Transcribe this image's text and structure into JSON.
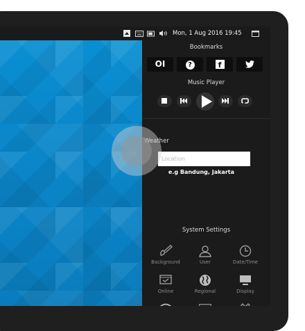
{
  "status_bar": {
    "datetime": "Mon, 1 Aug 2016 19:45"
  },
  "bookmarks": {
    "title": "Bookmarks",
    "items": [
      {
        "glyph": "OI",
        "icon": "opera-icon"
      },
      {
        "glyph": "?",
        "icon": "help-icon"
      },
      {
        "glyph": "f",
        "icon": "facebook-icon"
      },
      {
        "glyph": "t",
        "icon": "twitter-icon"
      }
    ]
  },
  "music_player": {
    "title": "Music Player"
  },
  "weather": {
    "title": "Weather",
    "location_placeholder": "Location",
    "hint": "e.g Bandung, Jakarta"
  },
  "system_settings": {
    "title": "System Settings",
    "items": [
      {
        "label": "Background",
        "icon": "paint-icon"
      },
      {
        "label": "User",
        "icon": "user-icon"
      },
      {
        "label": "Date/Time",
        "icon": "clock-icon"
      },
      {
        "label": "Online",
        "icon": "online-icon"
      },
      {
        "label": "Regional",
        "icon": "globe-icon"
      },
      {
        "label": "Display",
        "icon": "monitor-icon"
      },
      {
        "label": "",
        "icon": "wifi-icon"
      },
      {
        "label": "",
        "icon": "keyboard-icon"
      },
      {
        "label": "",
        "icon": "tools-icon"
      }
    ]
  },
  "colors": {
    "accent": "#0a86c8",
    "panel": "#1b1b1b"
  }
}
